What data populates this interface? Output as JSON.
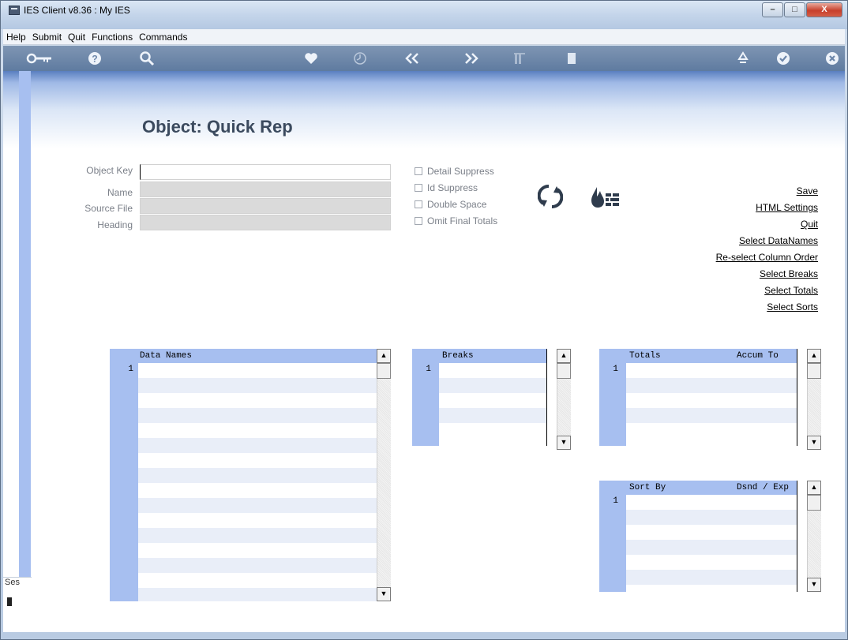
{
  "window": {
    "title": "IES Client v8.36 : My IES",
    "min": "–",
    "max": "□",
    "close": "X"
  },
  "menu": [
    "Help",
    "Submit",
    "Quit",
    "Functions",
    "Commands"
  ],
  "page": {
    "title": "Object: Quick Rep"
  },
  "form": {
    "object_key": {
      "label": "Object Key",
      "value": ""
    },
    "name": {
      "label": "Name",
      "value": ""
    },
    "source_file": {
      "label": "Source File",
      "value": ""
    },
    "heading": {
      "label": "Heading",
      "value": ""
    }
  },
  "options": [
    {
      "label": "Detail Suppress",
      "checked": false
    },
    {
      "label": "Id Suppress",
      "checked": false
    },
    {
      "label": "Double Space",
      "checked": false
    },
    {
      "label": "Omit Final Totals",
      "checked": false
    }
  ],
  "links": [
    "Save",
    "HTML Settings",
    "Quit",
    "Select DataNames",
    "Re-select Column Order",
    "Select Breaks",
    "Select Totals",
    "Select Sorts"
  ],
  "grids": {
    "data_names": {
      "header": "Data Names",
      "row1": "1"
    },
    "breaks": {
      "header": "Breaks",
      "row1": "1"
    },
    "totals": {
      "header": "Totals",
      "header2": "Accum To",
      "row1": "1"
    },
    "sort_by": {
      "header": "Sort By",
      "header2": "Dsnd / Exp",
      "row1": "1"
    }
  },
  "session": {
    "label": "Ses"
  },
  "colors": {
    "accent": "#a7bff0",
    "toolbar": "#6c86aa",
    "header_band": "#5a7fc0"
  }
}
